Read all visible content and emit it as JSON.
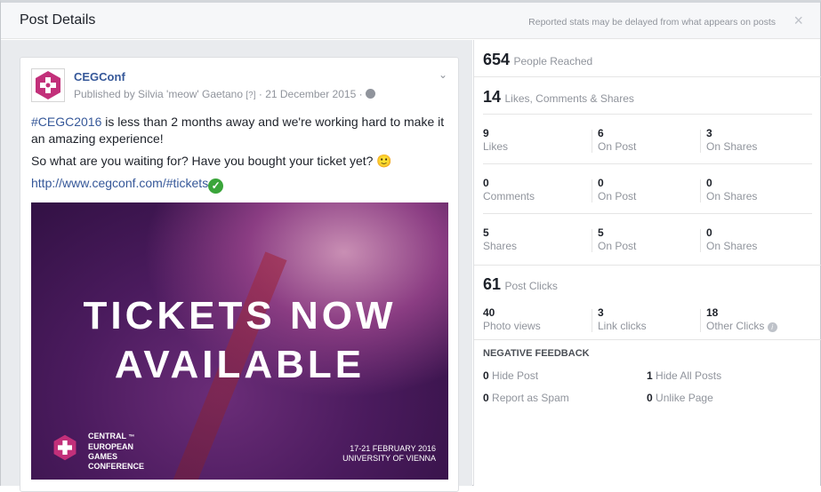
{
  "dialog": {
    "title": "Post Details",
    "notice": "Reported stats may be delayed from what appears on posts",
    "close_label": "×"
  },
  "post": {
    "page_name": "CEGConf",
    "published_by": "Published by Silvia 'meow' Gaetano",
    "help_mark": "[?]",
    "separator": "·",
    "date": "21 December 2015",
    "globe_icon": "globe-icon",
    "hashtag": "#CEGC2016",
    "text1_rest": " is less than 2 months away and we're working hard to make it an amazing experience!",
    "text2": "So what are you waiting for? Have you bought your ticket yet? 🙂",
    "link": "http://www.cegconf.com/#tickets",
    "banner": {
      "line1": "TICKETS NOW",
      "line2": "AVAILABLE",
      "org_line1": "CENTRAL",
      "org_line2": "EUROPEAN",
      "org_line3": "GAMES",
      "org_line4": "CONFERENCE",
      "tm": "™",
      "dates": "17-21 FEBRUARY 2016",
      "venue": "UNIVERSITY OF VIENNA"
    }
  },
  "stats": {
    "reached": {
      "value": "654",
      "label": "People Reached"
    },
    "engagement": {
      "value": "14",
      "label": "Likes, Comments & Shares"
    },
    "rows": [
      {
        "cells": [
          {
            "n": "9",
            "l": "Likes"
          },
          {
            "n": "6",
            "l": "On Post"
          },
          {
            "n": "3",
            "l": "On Shares"
          }
        ]
      },
      {
        "cells": [
          {
            "n": "0",
            "l": "Comments"
          },
          {
            "n": "0",
            "l": "On Post"
          },
          {
            "n": "0",
            "l": "On Shares"
          }
        ]
      },
      {
        "cells": [
          {
            "n": "5",
            "l": "Shares"
          },
          {
            "n": "5",
            "l": "On Post"
          },
          {
            "n": "0",
            "l": "On Shares"
          }
        ]
      }
    ],
    "clicks": {
      "value": "61",
      "label": "Post Clicks"
    },
    "click_cells": [
      {
        "n": "40",
        "l": "Photo views"
      },
      {
        "n": "3",
        "l": "Link clicks"
      },
      {
        "n": "18",
        "l": "Other Clicks"
      }
    ],
    "negative": {
      "title": "NEGATIVE FEEDBACK",
      "items": [
        {
          "n": "0",
          "l": "Hide Post"
        },
        {
          "n": "1",
          "l": "Hide All Posts"
        },
        {
          "n": "0",
          "l": "Report as Spam"
        },
        {
          "n": "0",
          "l": "Unlike Page"
        }
      ]
    }
  }
}
